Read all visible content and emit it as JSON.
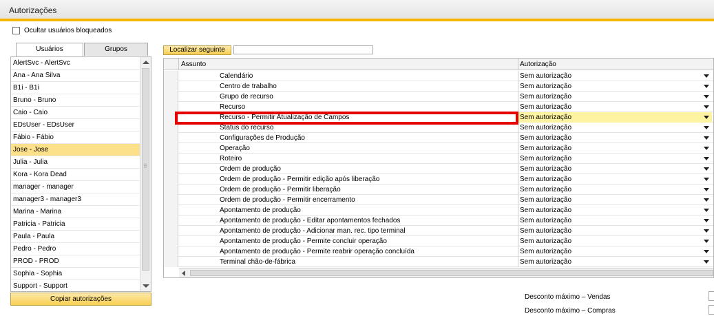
{
  "window": {
    "title": "Autorizações"
  },
  "hide_blocked": {
    "label": "Ocultar usuários bloqueados",
    "checked": false
  },
  "tabs": [
    {
      "label": "Usuários",
      "active": true
    },
    {
      "label": "Grupos",
      "active": false
    }
  ],
  "users": [
    "AlertSvc - AlertSvc",
    "Ana - Ana Silva",
    "B1i - B1i",
    "Bruno - Bruno",
    "Caio - Caio",
    "EDsUser - EDsUser",
    "Fábio - Fábio",
    "Jose - Jose",
    "Julia - Julia",
    "Kora - Kora Dead",
    "manager - manager",
    "manager3 - manager3",
    "Marina - Marina",
    "Patricia - Patricia",
    "Paula - Paula",
    "Pedro - Pedro",
    "PROD - PROD",
    "Sophia - Sophia",
    "Support - Support"
  ],
  "selected_user_index": 7,
  "copy_button": "Copiar autorizações",
  "find": {
    "button": "Localizar seguinte",
    "value": ""
  },
  "grid": {
    "columns": {
      "subject": "Assunto",
      "authorization": "Autorização"
    },
    "rows": [
      {
        "subject": "Calendário",
        "authorization": "Sem autorização"
      },
      {
        "subject": "Centro de trabalho",
        "authorization": "Sem autorização"
      },
      {
        "subject": "Grupo de recurso",
        "authorization": "Sem autorização"
      },
      {
        "subject": "Recurso",
        "authorization": "Sem autorização"
      },
      {
        "subject": "Recurso - Permitir Atualização de Campos",
        "authorization": "Sem autorização",
        "highlighted": true
      },
      {
        "subject": "Status do recurso",
        "authorization": "Sem autorização"
      },
      {
        "subject": "Configurações de Produção",
        "authorization": "Sem autorização"
      },
      {
        "subject": "Operação",
        "authorization": "Sem autorização"
      },
      {
        "subject": "Roteiro",
        "authorization": "Sem autorização"
      },
      {
        "subject": "Ordem de produção",
        "authorization": "Sem autorização"
      },
      {
        "subject": "Ordem de produção - Permitir edição após liberação",
        "authorization": "Sem autorização"
      },
      {
        "subject": "Ordem de produção - Permitir liberação",
        "authorization": "Sem autorização"
      },
      {
        "subject": "Ordem de produção - Permitir encerramento",
        "authorization": "Sem autorização"
      },
      {
        "subject": "Apontamento de produção",
        "authorization": "Sem autorização"
      },
      {
        "subject": "Apontamento de produção - Editar apontamentos fechados",
        "authorization": "Sem autorização"
      },
      {
        "subject": "Apontamento de produção - Adicionar man. rec. tipo terminal",
        "authorization": "Sem autorização"
      },
      {
        "subject": "Apontamento de produção - Permite concluir operação",
        "authorization": "Sem autorização"
      },
      {
        "subject": "Apontamento de produção - Permite reabrir operação concluída",
        "authorization": "Sem autorização"
      },
      {
        "subject": "Terminal chão-de-fábrica",
        "authorization": "Sem autorização"
      }
    ]
  },
  "discounts": {
    "sales": {
      "label": "Desconto máximo – Vendas",
      "value": ""
    },
    "purchases": {
      "label": "Desconto máximo – Compras",
      "value": ""
    }
  },
  "colors": {
    "accent": "#f7b500",
    "selection": "#fde08a",
    "highlight_box": "#e60000"
  }
}
